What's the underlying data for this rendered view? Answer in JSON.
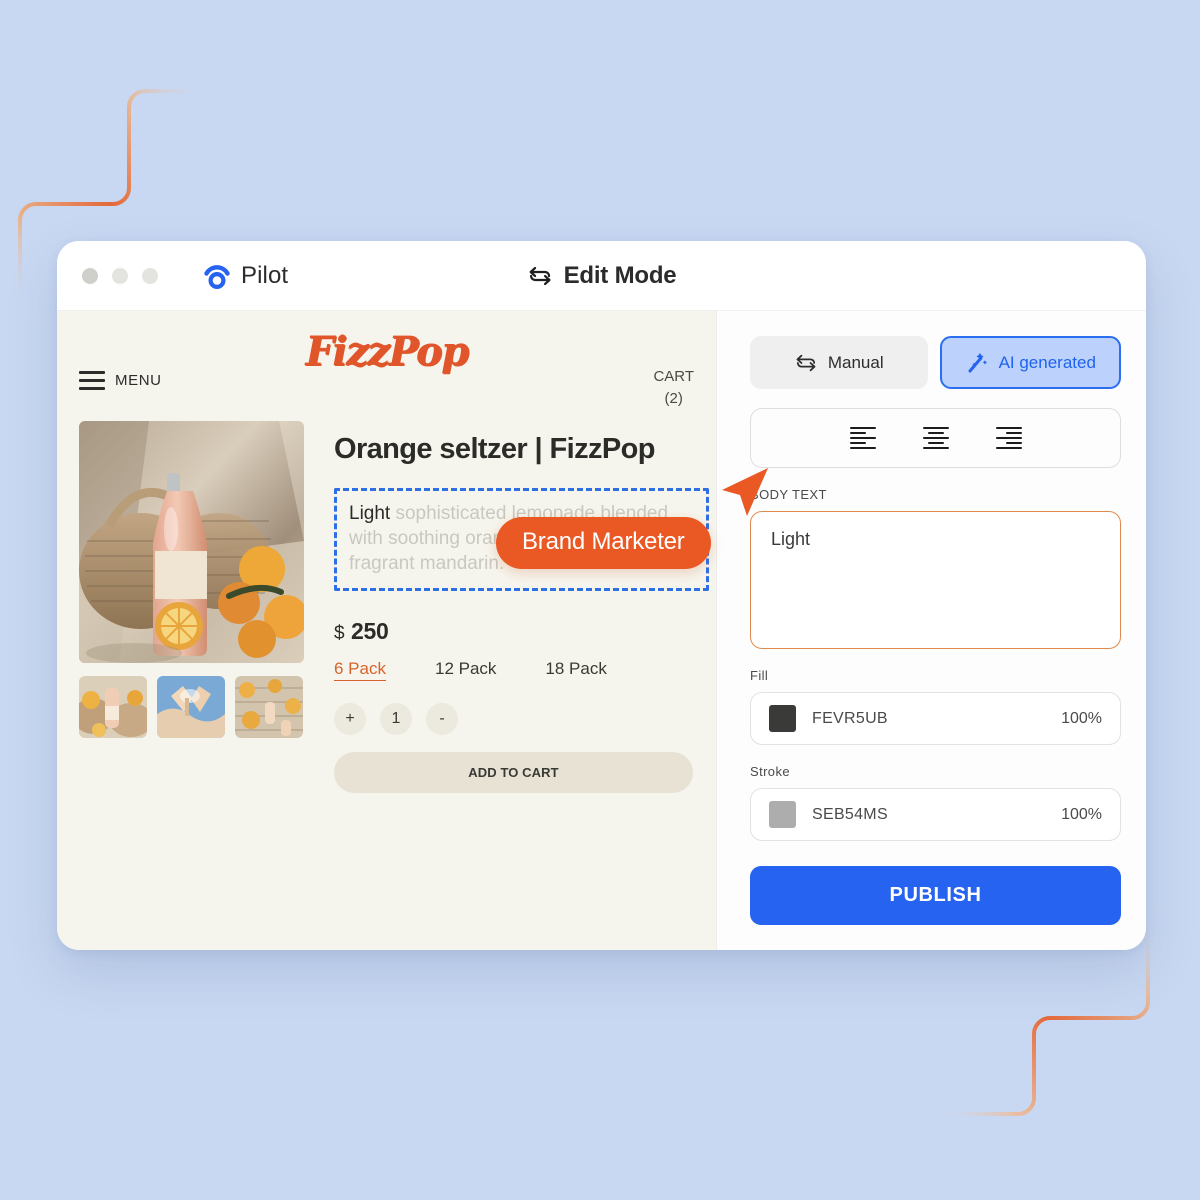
{
  "window": {
    "brand_name": "Pilot",
    "mode_label": "Edit Mode",
    "brand_icon": "pilot-logo-icon",
    "mode_icon": "swap-cycle-icon"
  },
  "site": {
    "logo_text": "FizzPop",
    "menu_label": "MENU",
    "cart_label": "CART",
    "cart_count": "(2)"
  },
  "product": {
    "title": "Orange seltzer | FizzPop",
    "description_typed": "Light",
    "description_ghost": " sophisticated lemonade blended with soothing orange juice & a splash of fragrant mandarin.",
    "currency": "$",
    "price": "250",
    "packs": [
      {
        "label": "6 Pack",
        "selected": true
      },
      {
        "label": "12 Pack",
        "selected": false
      },
      {
        "label": "18 Pack",
        "selected": false
      }
    ],
    "qty_increase": "+",
    "qty_value": "1",
    "qty_decrease": "-",
    "add_to_cart": "ADD TO CART"
  },
  "collaborator": {
    "badge_label": "Brand Marketer",
    "badge_color": "#ea5823",
    "cursor_color": "#ea5823",
    "selection_color": "#2f6fe4"
  },
  "panel": {
    "mode_tabs": [
      {
        "label": "Manual",
        "icon": "swap-cycle-icon",
        "active": false
      },
      {
        "label": "AI generated",
        "icon": "magic-wand-icon",
        "active": true
      }
    ],
    "alignment": [
      {
        "name": "align-left",
        "active": false
      },
      {
        "name": "align-center",
        "active": false
      },
      {
        "name": "align-right",
        "active": false
      }
    ],
    "body_text_label": "BODY TEXT",
    "body_text_value": "Light",
    "fill_label": "Fill",
    "fill_code": "FEVR5UB",
    "fill_opacity": "100%",
    "fill_color": "#3a3a38",
    "stroke_label": "Stroke",
    "stroke_code": "SEB54MS",
    "stroke_opacity": "100%",
    "stroke_color": "#adadad",
    "publish_label": "PUBLISH",
    "publish_color": "#2563f0"
  },
  "theme": {
    "page_background": "#c8d8f2",
    "preview_background": "#f6f5ed",
    "accent_orange": "#e0562a",
    "accent_blue": "#2563f0"
  }
}
